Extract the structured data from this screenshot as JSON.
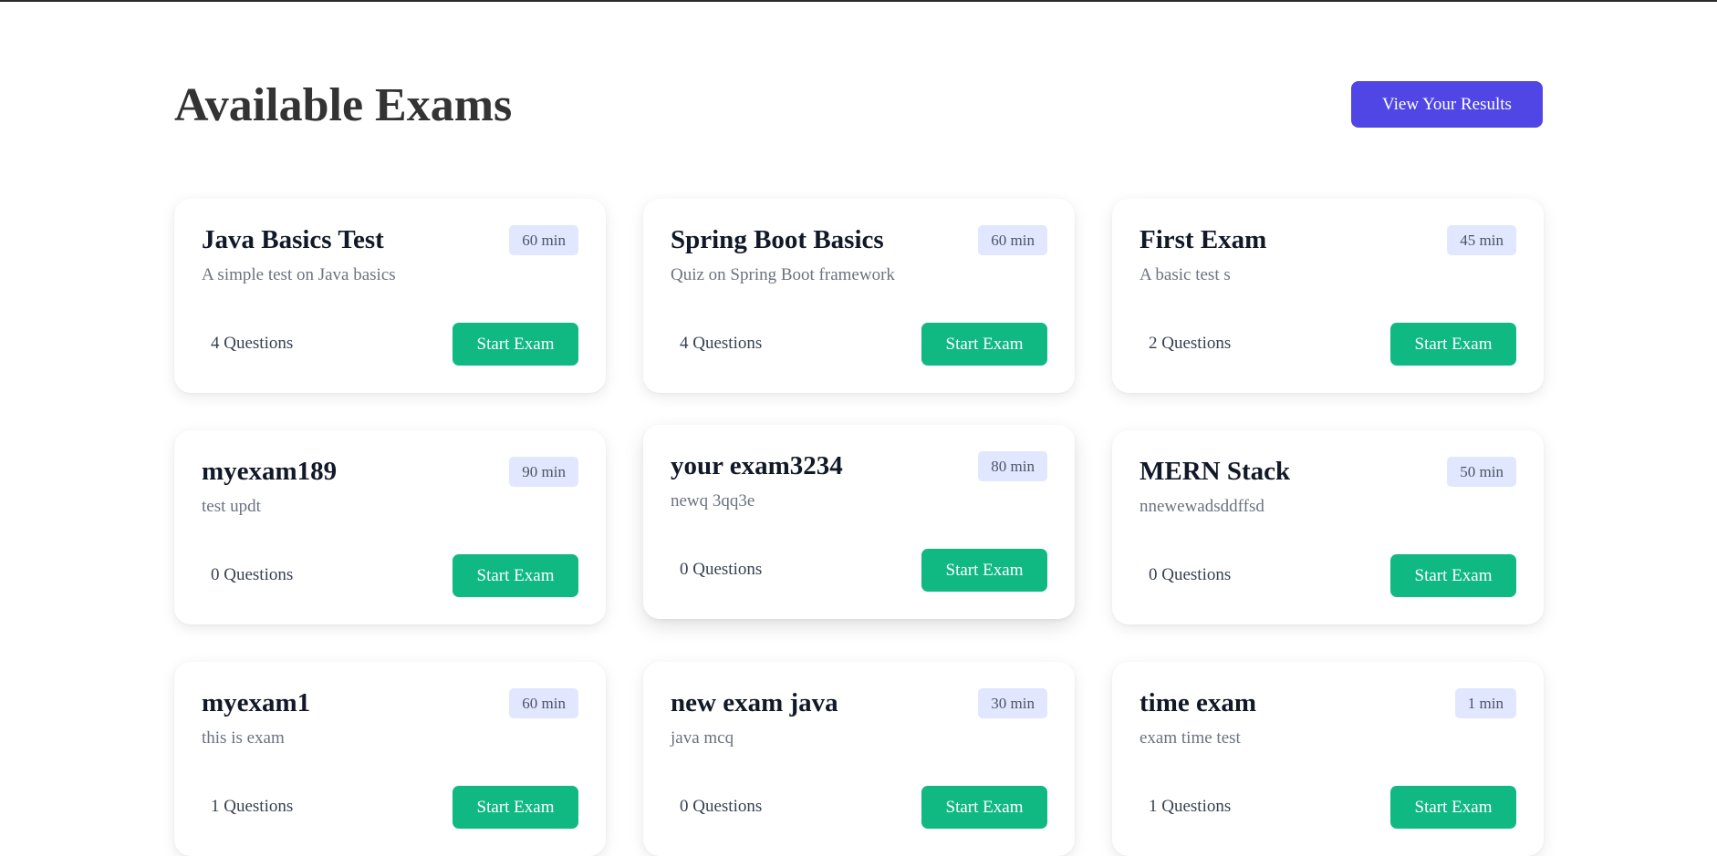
{
  "header": {
    "title": "Available Exams",
    "results_button": "View Your Results"
  },
  "exams": [
    {
      "title": "Java Basics Test",
      "duration": "60 min",
      "description": "A simple test on Java basics",
      "questions": "4 Questions",
      "action": "Start Exam"
    },
    {
      "title": "Spring Boot Basics",
      "duration": "60 min",
      "description": "Quiz on Spring Boot framework",
      "questions": "4 Questions",
      "action": "Start Exam"
    },
    {
      "title": "First Exam",
      "duration": "45 min",
      "description": "A basic test s",
      "questions": "2 Questions",
      "action": "Start Exam"
    },
    {
      "title": "myexam189",
      "duration": "90 min",
      "description": "test updt",
      "questions": "0 Questions",
      "action": "Start Exam"
    },
    {
      "title": "your exam3234",
      "duration": "80 min",
      "description": "newq 3qq3e",
      "questions": "0 Questions",
      "action": "Start Exam"
    },
    {
      "title": "MERN Stack",
      "duration": "50 min",
      "description": "nnewewadsddffsd",
      "questions": "0 Questions",
      "action": "Start Exam"
    },
    {
      "title": "myexam1",
      "duration": "60 min",
      "description": "this is exam",
      "questions": "1 Questions",
      "action": "Start Exam"
    },
    {
      "title": "new exam java",
      "duration": "30 min",
      "description": "java mcq",
      "questions": "0 Questions",
      "action": "Start Exam"
    },
    {
      "title": "time exam",
      "duration": "1 min",
      "description": "exam time test",
      "questions": "1 Questions",
      "action": "Start Exam"
    }
  ]
}
